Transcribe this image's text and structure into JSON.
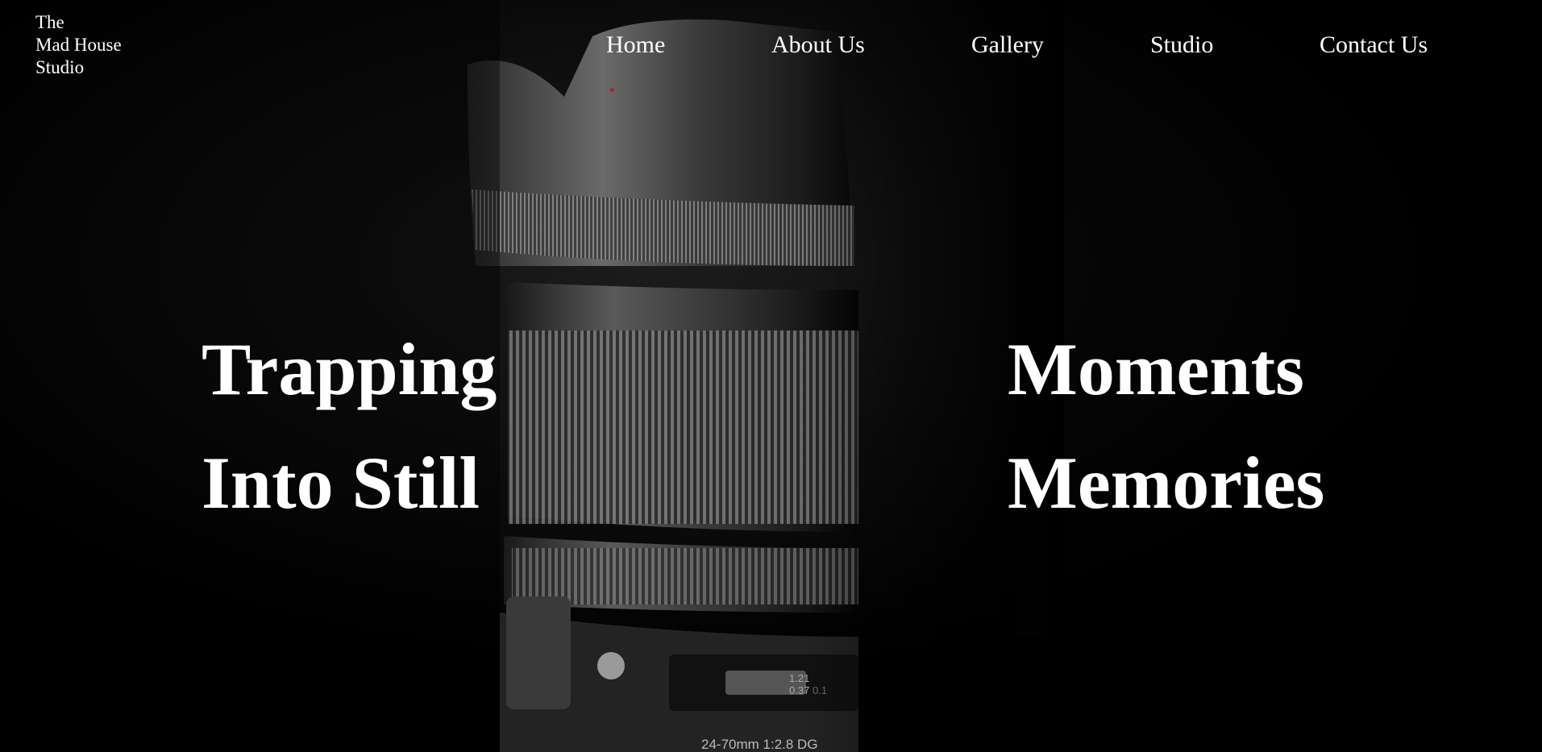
{
  "logo": {
    "line1": "The",
    "line2": "Mad House",
    "line3": "Studio"
  },
  "nav": {
    "home": "Home",
    "about": "About Us",
    "gallery": "Gallery",
    "studio": "Studio",
    "contact": "Contact Us"
  },
  "hero": {
    "left_line1": "Trapping",
    "left_line2": "Into Still",
    "right_line1": "Moments",
    "right_line2": "Memories",
    "lens_text_focus_top": "1.21",
    "lens_text_focus_bottom": "0.37",
    "lens_text_focus_unit": "0.1",
    "lens_spec": "24-70mm 1:2.8 DG"
  },
  "colors": {
    "background": "#000000",
    "text": "#ffffff",
    "cursor_dot": "#c0182a"
  }
}
